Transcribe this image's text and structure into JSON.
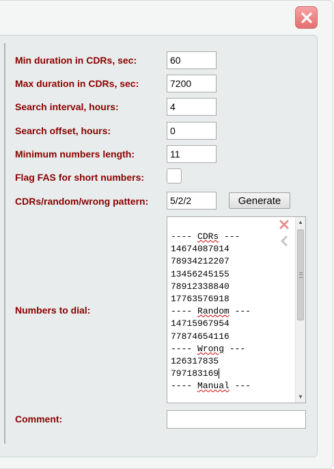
{
  "form": {
    "min_duration": {
      "label": "Min duration in CDRs, sec:",
      "value": "60"
    },
    "max_duration": {
      "label": "Max duration in CDRs, sec:",
      "value": "7200"
    },
    "search_interval": {
      "label": "Search interval, hours:",
      "value": "4"
    },
    "search_offset": {
      "label": "Search offset, hours:",
      "value": "0"
    },
    "min_numbers_length": {
      "label": "Minimum numbers length:",
      "value": "11"
    },
    "flag_fas": {
      "label": "Flag FAS for short numbers:",
      "checked": false
    },
    "pattern": {
      "label": "CDRs/random/wrong pattern:",
      "value": "5/2/2"
    },
    "generate_label": "Generate",
    "numbers_to_dial": {
      "label": "Numbers to dial:",
      "lines": [
        {
          "pre": "---- ",
          "word": "CDRs",
          "post": " ---"
        },
        {
          "pre": "14674087014",
          "word": "",
          "post": ""
        },
        {
          "pre": "78934212207",
          "word": "",
          "post": ""
        },
        {
          "pre": "13456245155",
          "word": "",
          "post": ""
        },
        {
          "pre": "78912338840",
          "word": "",
          "post": ""
        },
        {
          "pre": "17763576918",
          "word": "",
          "post": ""
        },
        {
          "pre": "---- ",
          "word": "Random",
          "post": " ---"
        },
        {
          "pre": "14715967954",
          "word": "",
          "post": ""
        },
        {
          "pre": "77874654116",
          "word": "",
          "post": ""
        },
        {
          "pre": "---- ",
          "word": "Wrong",
          "post": " ---"
        },
        {
          "pre": "126317835",
          "word": "",
          "post": ""
        },
        {
          "pre": "797183169",
          "word": "",
          "post": "",
          "caret": true
        },
        {
          "pre": "---- ",
          "word": "Manual",
          "post": " ---"
        }
      ]
    },
    "comment": {
      "label": "Comment:",
      "value": ""
    }
  },
  "icons": {
    "close": "close-icon",
    "clear": "clear-x-icon",
    "back": "chevron-left-icon",
    "scroll_up": "triangle-up-icon",
    "scroll_down": "triangle-down-icon"
  },
  "colors": {
    "label": "#8b0000",
    "close_button": "#e46f6f",
    "panel_background": "#e8ecec"
  }
}
